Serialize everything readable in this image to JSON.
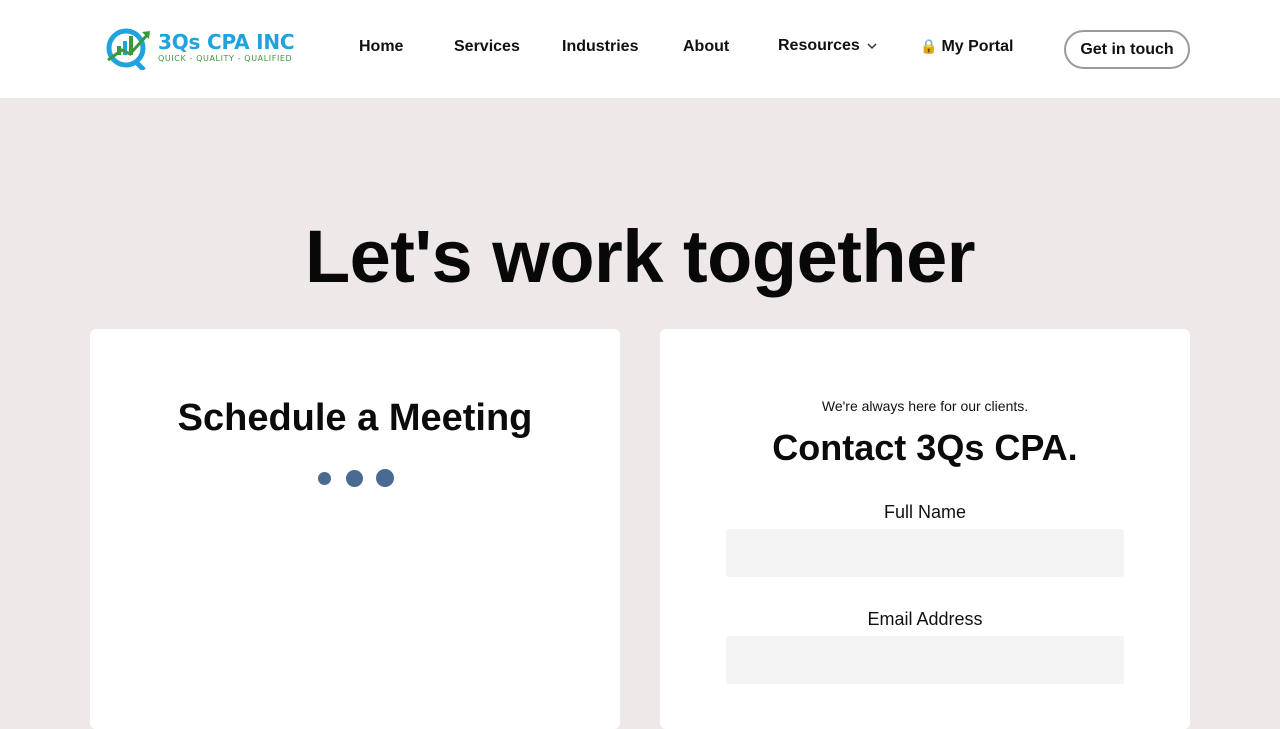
{
  "brand": {
    "name": "3Qs CPA INC",
    "tagline": "QUICK - QUALITY - QUALIFIED",
    "colors": {
      "primary": "#1fa3df",
      "secondary": "#3a9a3a",
      "accent_dots": "#4b6a91"
    }
  },
  "nav": {
    "home": "Home",
    "services": "Services",
    "industries": "Industries",
    "about": "About",
    "resources": "Resources",
    "portal_icon": "lock-icon",
    "portal_lock_glyph": "🔒",
    "portal": "My Portal",
    "cta": "Get in touch"
  },
  "hero": {
    "title": "Let's work together"
  },
  "schedule": {
    "title": "Schedule a Meeting"
  },
  "contact": {
    "kicker": "We're always here for our clients.",
    "title": "Contact 3Qs CPA.",
    "fields": {
      "full_name": {
        "label": "Full Name",
        "value": "",
        "placeholder": ""
      },
      "email": {
        "label": "Email Address",
        "value": "",
        "placeholder": ""
      }
    }
  }
}
